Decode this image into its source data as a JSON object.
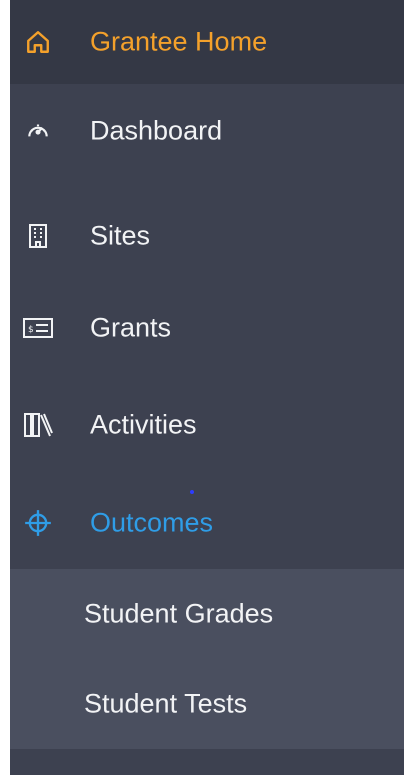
{
  "sidebar": {
    "items": [
      {
        "label": "Grantee Home",
        "icon": "home-icon",
        "active": true
      },
      {
        "label": "Dashboard",
        "icon": "speedometer-icon"
      },
      {
        "label": "Sites",
        "icon": "building-icon"
      },
      {
        "label": "Grants",
        "icon": "money-card-icon"
      },
      {
        "label": "Activities",
        "icon": "library-icon"
      },
      {
        "label": "Outcomes",
        "icon": "crosshair-icon",
        "expanded": true
      }
    ],
    "subitems": [
      {
        "label": "Student Grades"
      },
      {
        "label": "Student Tests"
      }
    ],
    "colors": {
      "sidebar_bg": "#3d4150",
      "top_bg": "#343845",
      "submenu_bg": "#4a4f5f",
      "home_accent": "#f4a12b",
      "outcomes_accent": "#2f9de7",
      "text": "#f2f3f5"
    }
  }
}
